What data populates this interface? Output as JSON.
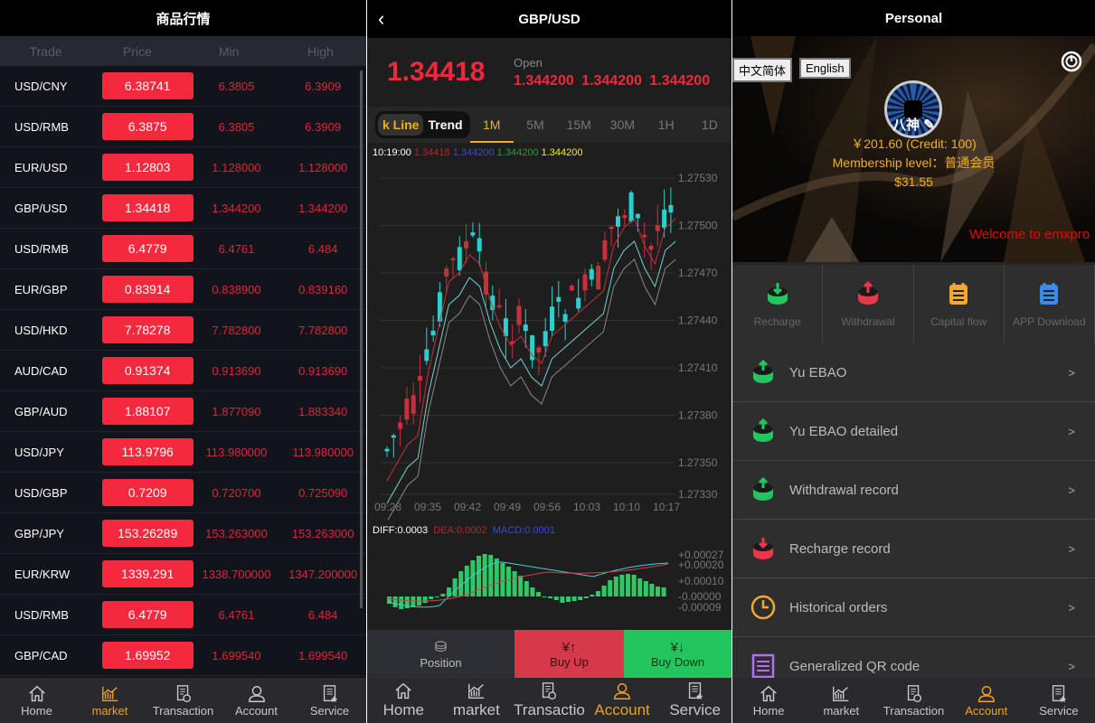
{
  "market": {
    "title": "商品行情",
    "columns": [
      "Trade",
      "Price",
      "Min",
      "High"
    ],
    "rows": [
      [
        "USD/CNY",
        "6.38741",
        "6.3805",
        "6.3909"
      ],
      [
        "USD/RMB",
        "6.3875",
        "6.3805",
        "6.3909"
      ],
      [
        "EUR/USD",
        "1.12803",
        "1.128000",
        "1.128000"
      ],
      [
        "GBP/USD",
        "1.34418",
        "1.344200",
        "1.344200"
      ],
      [
        "USD/RMB",
        "6.4779",
        "6.4761",
        "6.484"
      ],
      [
        "EUR/GBP",
        "0.83914",
        "0.838900",
        "0.839160"
      ],
      [
        "USD/HKD",
        "7.78278",
        "7.782800",
        "7.782800"
      ],
      [
        "AUD/CAD",
        "0.91374",
        "0.913690",
        "0.913690"
      ],
      [
        "GBP/AUD",
        "1.88107",
        "1.877090",
        "1.883340"
      ],
      [
        "USD/JPY",
        "113.9796",
        "113.980000",
        "113.980000"
      ],
      [
        "USD/GBP",
        "0.7209",
        "0.720700",
        "0.725090"
      ],
      [
        "GBP/JPY",
        "153.26289",
        "153.263000",
        "153.263000"
      ],
      [
        "EUR/KRW",
        "1339.291",
        "1338.700000",
        "1347.200000"
      ],
      [
        "USD/RMB",
        "6.4779",
        "6.4761",
        "6.484"
      ],
      [
        "GBP/CAD",
        "1.69952",
        "1.699540",
        "1.699540"
      ]
    ]
  },
  "nav": {
    "items": [
      "Home",
      "market",
      "Transaction",
      "Account",
      "Service"
    ]
  },
  "detail": {
    "title": "GBP/USD",
    "price": "1.34418",
    "open_label": "Open",
    "open_values": "1.344200 1.344200 1.344200",
    "seg": [
      "k Line",
      "Trend"
    ],
    "timeframes": [
      "1M",
      "5M",
      "15M",
      "30M",
      "1H",
      "1D"
    ],
    "info": {
      "time": "10:19:00",
      "a": "1.34418",
      "b": "1.344200",
      "c": "1.344200",
      "d": "1.344200"
    },
    "y_labels": [
      "1.27530",
      "1.27500",
      "1.27470",
      "1.27440",
      "1.27410",
      "1.27380",
      "1.27350",
      "1.27330"
    ],
    "x_labels": [
      "09:28",
      "09:35",
      "09:42",
      "09:49",
      "09:56",
      "10:03",
      "10:10",
      "10:17"
    ],
    "macd": {
      "diff": "DIFF:0.0003",
      "dea": "DEA:0.0002",
      "macd": "MACD:0.0001",
      "y_labels": [
        "+0.00027",
        "+0.00020",
        "+0.00010",
        "-0.00000",
        "-0.00009"
      ]
    },
    "actions": [
      "Position",
      "Buy Up",
      "Buy Down"
    ],
    "transaction_label": "Transactio"
  },
  "account": {
    "title": "Personal",
    "lang": [
      "中文简体",
      "English"
    ],
    "name": "八神",
    "balance": "￥201.60 (Credit: 100)",
    "level": "Membership level：普通会员",
    "usd": "$31.55",
    "marquee": "Welcome to emxpro",
    "quick": [
      "Recharge",
      "Withdrawal",
      "Capital flow",
      "APP Download"
    ],
    "menu": [
      "Yu EBAO",
      "Yu EBAO detailed",
      "Withdrawal record",
      "Recharge record",
      "Historical orders",
      "Generalized QR code"
    ]
  },
  "colors": {
    "up": "#f5293e",
    "down": "#22c55e",
    "accent": "#f0b020"
  }
}
